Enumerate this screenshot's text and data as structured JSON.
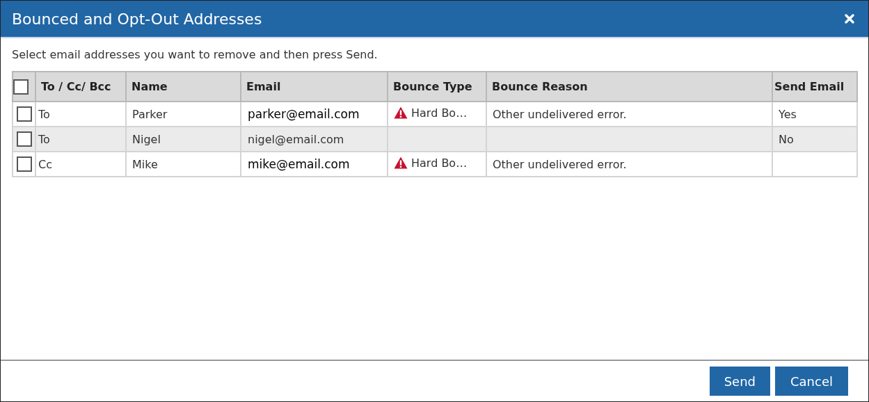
{
  "window": {
    "title": "Bounced and Opt-Out Addresses"
  },
  "instruction": "Select email addresses you want to remove and then press Send.",
  "table": {
    "select_all": {
      "checked": false
    },
    "columns": [
      "To / Cc/ Bcc",
      "Name",
      "Email",
      "Bounce Type",
      "Bounce Reason",
      "Send Email"
    ],
    "rows": [
      {
        "checked": false,
        "recipient": "To",
        "name": "Parker",
        "email": "parker@email.com",
        "bounce_type": "Hard Bo…",
        "bounce_reason": "Other undelivered error.",
        "send_email": "Yes"
      },
      {
        "checked": false,
        "recipient": "To",
        "name": "Nigel",
        "email": "nigel@email.com",
        "send_email": "No"
      },
      {
        "checked": false,
        "recipient": "Cc",
        "name": "Mike",
        "email": "mike@email.com",
        "bounce_type": "Hard Bo…",
        "bounce_reason": "Other undelivered error."
      }
    ]
  },
  "buttons": [
    "Send",
    "Cancel"
  ]
}
